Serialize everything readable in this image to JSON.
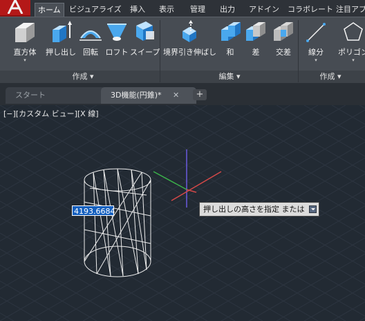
{
  "ribbon_tabs": [
    "ホーム",
    "ビジュアライズ",
    "挿入",
    "表示",
    "管理",
    "出力",
    "アドイン",
    "コラボレート",
    "注目アプ"
  ],
  "tools": {
    "box": "直方体",
    "extrude": "押し出し",
    "revolve": "回転",
    "loft": "ロフト",
    "sweep": "スイープ",
    "presspull": "境界引き伸ばし",
    "union": "和",
    "subtract": "差",
    "intersect": "交差",
    "line": "線分",
    "polygon": "ポリゴン"
  },
  "panels": {
    "create": "作成 ▾",
    "edit": "編集 ▾",
    "draw": "作成 ▾"
  },
  "doc_tabs": {
    "start": "スタート",
    "active": "3D機能(円錐)*",
    "close": "✕",
    "new": "+"
  },
  "viewport": {
    "view_controls": "[−][カスタム ビュー][X 線]"
  },
  "dynamic_input": {
    "value": "4193.6684"
  },
  "prompt": {
    "text": "押し出しの高さを指定 または"
  },
  "colors": {
    "app_button": "#b41818",
    "viewport_bg": "#222a33",
    "ribbon_bg": "#474c53",
    "input_highlight": "#1560bf"
  },
  "icons": [
    "box-icon",
    "extrude-icon",
    "revolve-icon",
    "loft-icon",
    "sweep-icon",
    "presspull-icon",
    "union-icon",
    "subtract-icon",
    "intersect-icon",
    "line-icon",
    "polygon-icon",
    "ucs-icon"
  ]
}
